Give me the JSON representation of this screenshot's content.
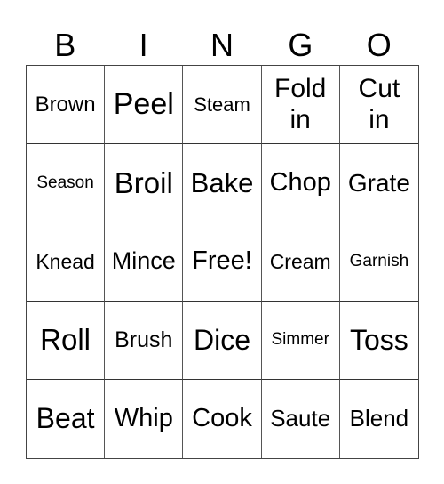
{
  "header": [
    "B",
    "I",
    "N",
    "G",
    "O"
  ],
  "cells": [
    {
      "text": "Brown",
      "size": 24
    },
    {
      "text": "Peel",
      "size": 34
    },
    {
      "text": "Steam",
      "size": 22
    },
    {
      "text": "Fold in",
      "size": 30
    },
    {
      "text": "Cut in",
      "size": 30
    },
    {
      "text": "Season",
      "size": 19
    },
    {
      "text": "Broil",
      "size": 33
    },
    {
      "text": "Bake",
      "size": 31
    },
    {
      "text": "Chop",
      "size": 29
    },
    {
      "text": "Grate",
      "size": 28
    },
    {
      "text": "Knead",
      "size": 23
    },
    {
      "text": "Mince",
      "size": 27
    },
    {
      "text": "Free!",
      "size": 29
    },
    {
      "text": "Cream",
      "size": 23
    },
    {
      "text": "Garnish",
      "size": 19
    },
    {
      "text": "Roll",
      "size": 33
    },
    {
      "text": "Brush",
      "size": 25
    },
    {
      "text": "Dice",
      "size": 32
    },
    {
      "text": "Simmer",
      "size": 19
    },
    {
      "text": "Toss",
      "size": 32
    },
    {
      "text": "Beat",
      "size": 32
    },
    {
      "text": "Whip",
      "size": 29
    },
    {
      "text": "Cook",
      "size": 29
    },
    {
      "text": "Saute",
      "size": 26
    },
    {
      "text": "Blend",
      "size": 26
    }
  ]
}
